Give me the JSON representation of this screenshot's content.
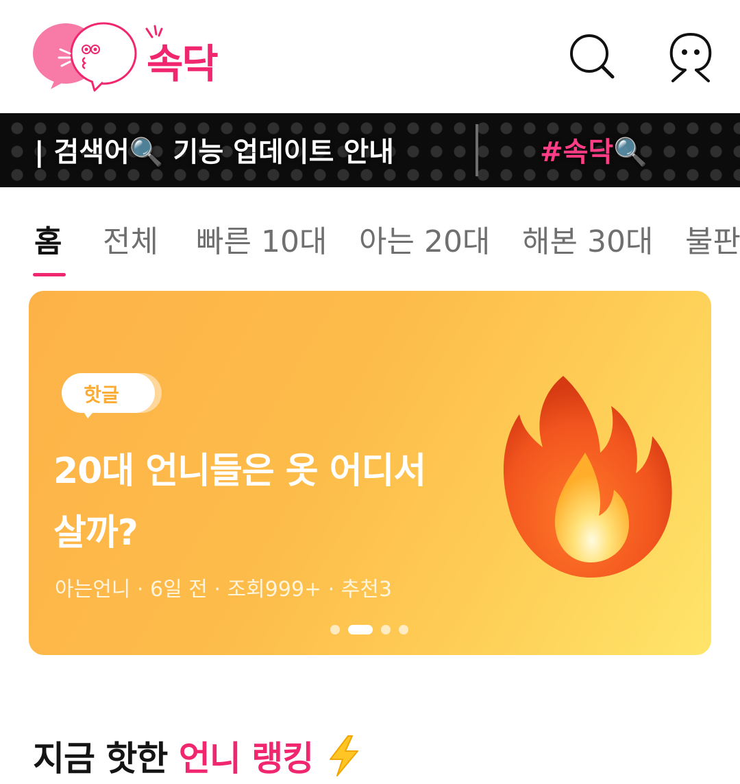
{
  "app": {
    "logo_text": "속닥"
  },
  "header": {
    "search_icon": "search-icon",
    "profile_icon": "profile-icon"
  },
  "ticker": {
    "item1": "| 검색어🔍 기능 업데이트 안내",
    "item2": "#속닥🔍"
  },
  "tabs": [
    {
      "label": "홈",
      "active": true
    },
    {
      "label": "전체"
    },
    {
      "label": "빠른 10대"
    },
    {
      "label": "아는 20대"
    },
    {
      "label": "해본 30대"
    },
    {
      "label": "불판"
    }
  ],
  "banner": {
    "badge": "핫글",
    "title_line1": "20대 언니들은 옷 어디서",
    "title_line2": "살까?",
    "meta": "아는언니 · 6일 전 · 조회999+ · 추천3",
    "icon": "fire-icon",
    "page_count": 4,
    "current_page": 2
  },
  "section": {
    "title_prefix": "지금 핫한",
    "title_highlight": "언니 랭킹",
    "icon": "lightning-icon"
  },
  "colors": {
    "brand_pink": "#f0266e",
    "banner_orange": "#fdb248",
    "banner_yellow": "#ffe56a",
    "ticker_bg": "#0c0c0c"
  }
}
